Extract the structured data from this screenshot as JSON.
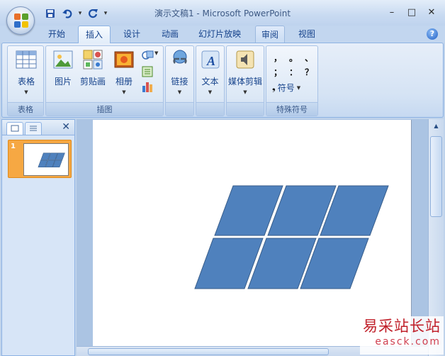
{
  "window": {
    "title": "演示文稿1 - Microsoft PowerPoint",
    "minimize": "–",
    "maximize": "□",
    "close": "✕"
  },
  "qat": {
    "save": "💾",
    "undo": "↶",
    "undo_dd": "▾",
    "redo": "↻",
    "customize": "▾"
  },
  "tabs": [
    {
      "label": "开始"
    },
    {
      "label": "插入"
    },
    {
      "label": "设计"
    },
    {
      "label": "动画"
    },
    {
      "label": "幻灯片放映"
    },
    {
      "label": "审阅"
    },
    {
      "label": "视图"
    }
  ],
  "active_tab": "插入",
  "help": "?",
  "ribbon": {
    "groups": {
      "tables": {
        "label": "表格",
        "buttons": {
          "table": "表格"
        }
      },
      "illustrations": {
        "label": "插图",
        "buttons": {
          "picture": "图片",
          "clipart": "剪贴画",
          "album": "相册"
        }
      },
      "links": {
        "buttons": {
          "hyperlink": "链接"
        }
      },
      "text": {
        "buttons": {
          "text": "文本"
        }
      },
      "media": {
        "buttons": {
          "media": "媒体剪辑"
        }
      },
      "special": {
        "label": "特殊符号",
        "symbols": [
          "，",
          "。",
          "、",
          "；",
          "：",
          "？"
        ],
        "symbol_button": "符号"
      }
    }
  },
  "slides_pane": {
    "close": "✕",
    "thumbnails": [
      {
        "number": "1"
      }
    ]
  },
  "watermark": {
    "cn": "易采站长站",
    "url": "easck.com"
  },
  "colors": {
    "shape_fill": "#4f81bd",
    "shape_stroke": "#385d8a",
    "thumb_highlight": "#f6a843"
  }
}
